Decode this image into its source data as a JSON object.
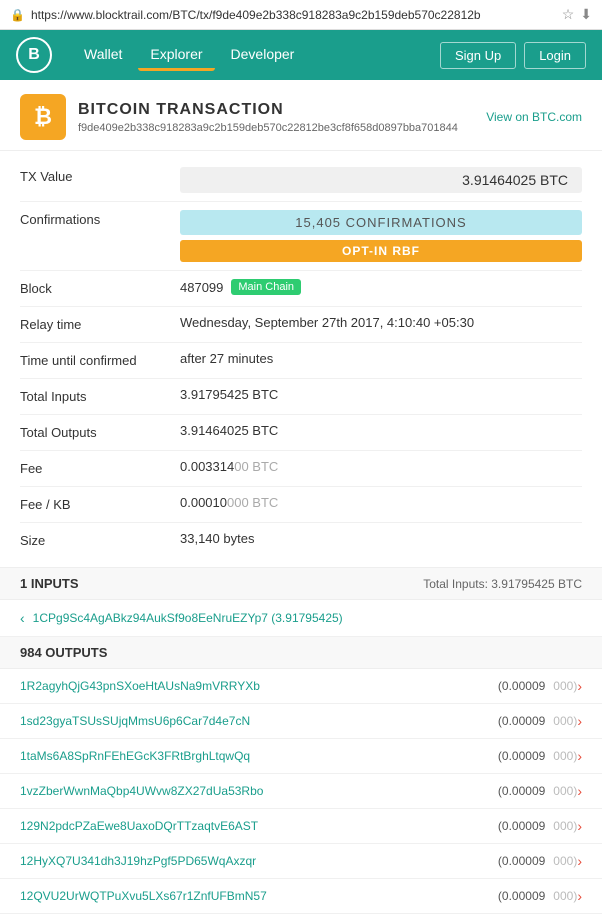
{
  "browser": {
    "url": "https://www.blocktrail.com/BTC/tx/f9de409e2b338c918283a9c2b159deb570c22812b",
    "favicon_color": "#1a9e8c"
  },
  "nav": {
    "logo": "B",
    "links": [
      "Wallet",
      "Explorer",
      "Developer"
    ],
    "active_link": "Explorer",
    "right_buttons": [
      "Sign Up",
      "Login"
    ]
  },
  "transaction": {
    "title": "BITCOIN TRANSACTION",
    "view_link": "View on BTC.com",
    "hash": "f9de409e2b338c918283a9c2b159deb570c22812be3cf8f658d0897bba701844",
    "tx_value": "3.91464025 BTC",
    "confirmations": "15,405 CONFIRMATIONS",
    "rbf": "OPT-IN RBF",
    "block_number": "487099",
    "block_badge": "Main Chain",
    "relay_time": "Wednesday, September 27th 2017, 4:10:40 +05:30",
    "time_until_confirmed": "after 27 minutes",
    "total_inputs": "3.91795425 BTC",
    "total_outputs": "3.91464025 BTC",
    "fee_label": "Fee",
    "fee": "0.003314",
    "fee_dim": "00 BTC",
    "fee_kb_label": "Fee / KB",
    "fee_kb": "0.00010",
    "fee_kb_dim": "000 BTC",
    "size": "33,140 bytes",
    "labels": {
      "tx_value": "TX Value",
      "confirmations": "Confirmations",
      "block": "Block",
      "relay_time": "Relay time",
      "time_until_confirmed": "Time until confirmed",
      "total_inputs": "Total Inputs",
      "total_outputs": "Total Outputs",
      "fee": "Fee",
      "fee_kb": "Fee / KB",
      "size": "Size"
    }
  },
  "inputs_section": {
    "header": "1 INPUTS",
    "total_label": "Total Inputs: 3.91795425 BTC",
    "items": [
      {
        "address": "1CPg9Sc4AgABkz94AukSf9o8EeNruEZYp7",
        "amount": "(3.91795425)"
      }
    ]
  },
  "outputs_section": {
    "header": "984 OUTPUTS",
    "items": [
      {
        "address": "1R2agyhQjG43pnSXoeHtAUsNa9mVRRYXb",
        "amount": "(0.00009",
        "amount_dim": "000)"
      },
      {
        "address": "1sd23gyaTSUsSUjqMmsU6p6Car7d4e7cN",
        "amount": "(0.00009",
        "amount_dim": "000)"
      },
      {
        "address": "1taMs6A8SpRnFEhEGcK3FRtBrghLtqwQq",
        "amount": "(0.00009",
        "amount_dim": "000)"
      },
      {
        "address": "1vzZberWwnMaQbp4UWvw8ZX27dUa53Rbo",
        "amount": "(0.00009",
        "amount_dim": "000)"
      },
      {
        "address": "129N2pdcPZaEwe8UaxoDQrTTzaqtvE6AST",
        "amount": "(0.00009",
        "amount_dim": "000)"
      },
      {
        "address": "12HyXQ7U341dh3J19hzPgf5PD65WqAxzqr",
        "amount": "(0.00009",
        "amount_dim": "000)"
      },
      {
        "address": "12QVU2UrWQTPuXvu5LXs67r1ZnfUFBmN57",
        "amount": "(0.00009",
        "amount_dim": "000)"
      }
    ]
  }
}
